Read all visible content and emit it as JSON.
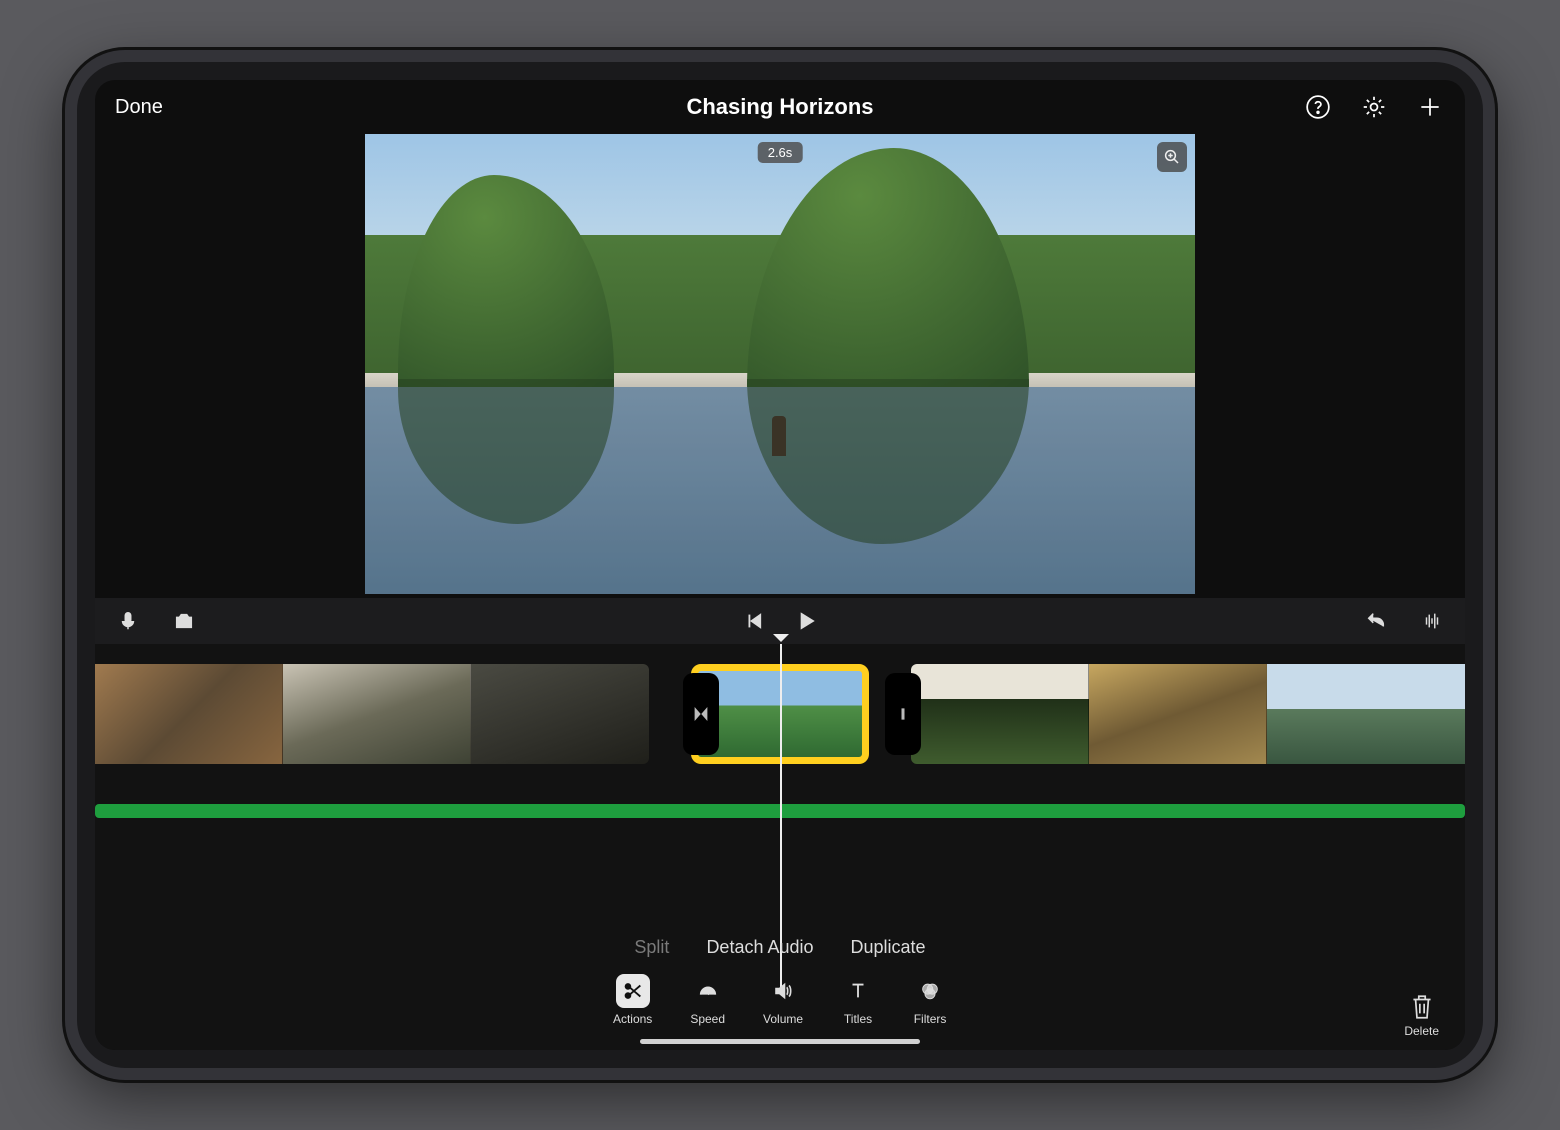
{
  "header": {
    "done_label": "Done",
    "title": "Chasing Horizons"
  },
  "viewer": {
    "duration_badge": "2.6s"
  },
  "action_menu": {
    "split": "Split",
    "detach_audio": "Detach Audio",
    "duplicate": "Duplicate"
  },
  "tools": {
    "actions": "Actions",
    "speed": "Speed",
    "volume": "Volume",
    "titles": "Titles",
    "filters": "Filters",
    "delete": "Delete"
  },
  "colors": {
    "selection": "#ffcf1f",
    "audio_track": "#1e9e3e"
  }
}
